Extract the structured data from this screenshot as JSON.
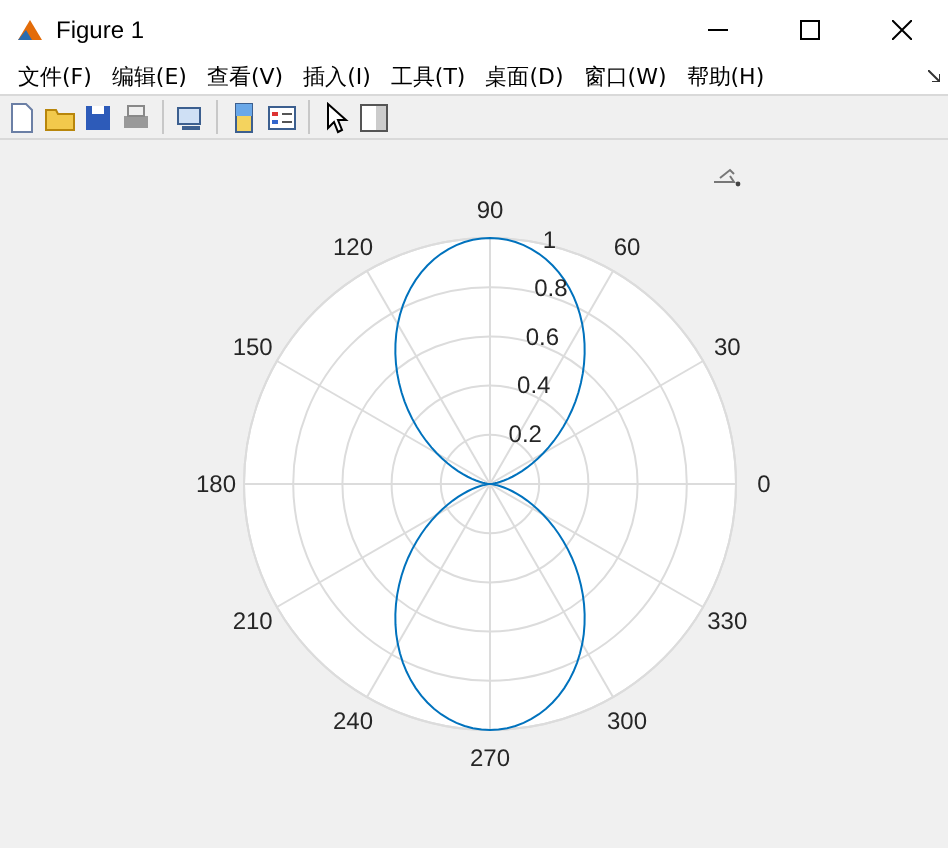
{
  "window": {
    "title": "Figure 1"
  },
  "menu": [
    {
      "label": "文件(F)"
    },
    {
      "label": "编辑(E)"
    },
    {
      "label": "查看(V)"
    },
    {
      "label": "插入(I)"
    },
    {
      "label": "工具(T)"
    },
    {
      "label": "桌面(D)"
    },
    {
      "label": "窗口(W)"
    },
    {
      "label": "帮助(H)"
    }
  ],
  "plot": {
    "angle_labels": [
      "0",
      "30",
      "60",
      "90",
      "120",
      "150",
      "180",
      "210",
      "240",
      "270",
      "300",
      "330"
    ],
    "radius_labels": [
      "1",
      "0.8",
      "0.6",
      "0.4",
      "0.2"
    ]
  }
}
